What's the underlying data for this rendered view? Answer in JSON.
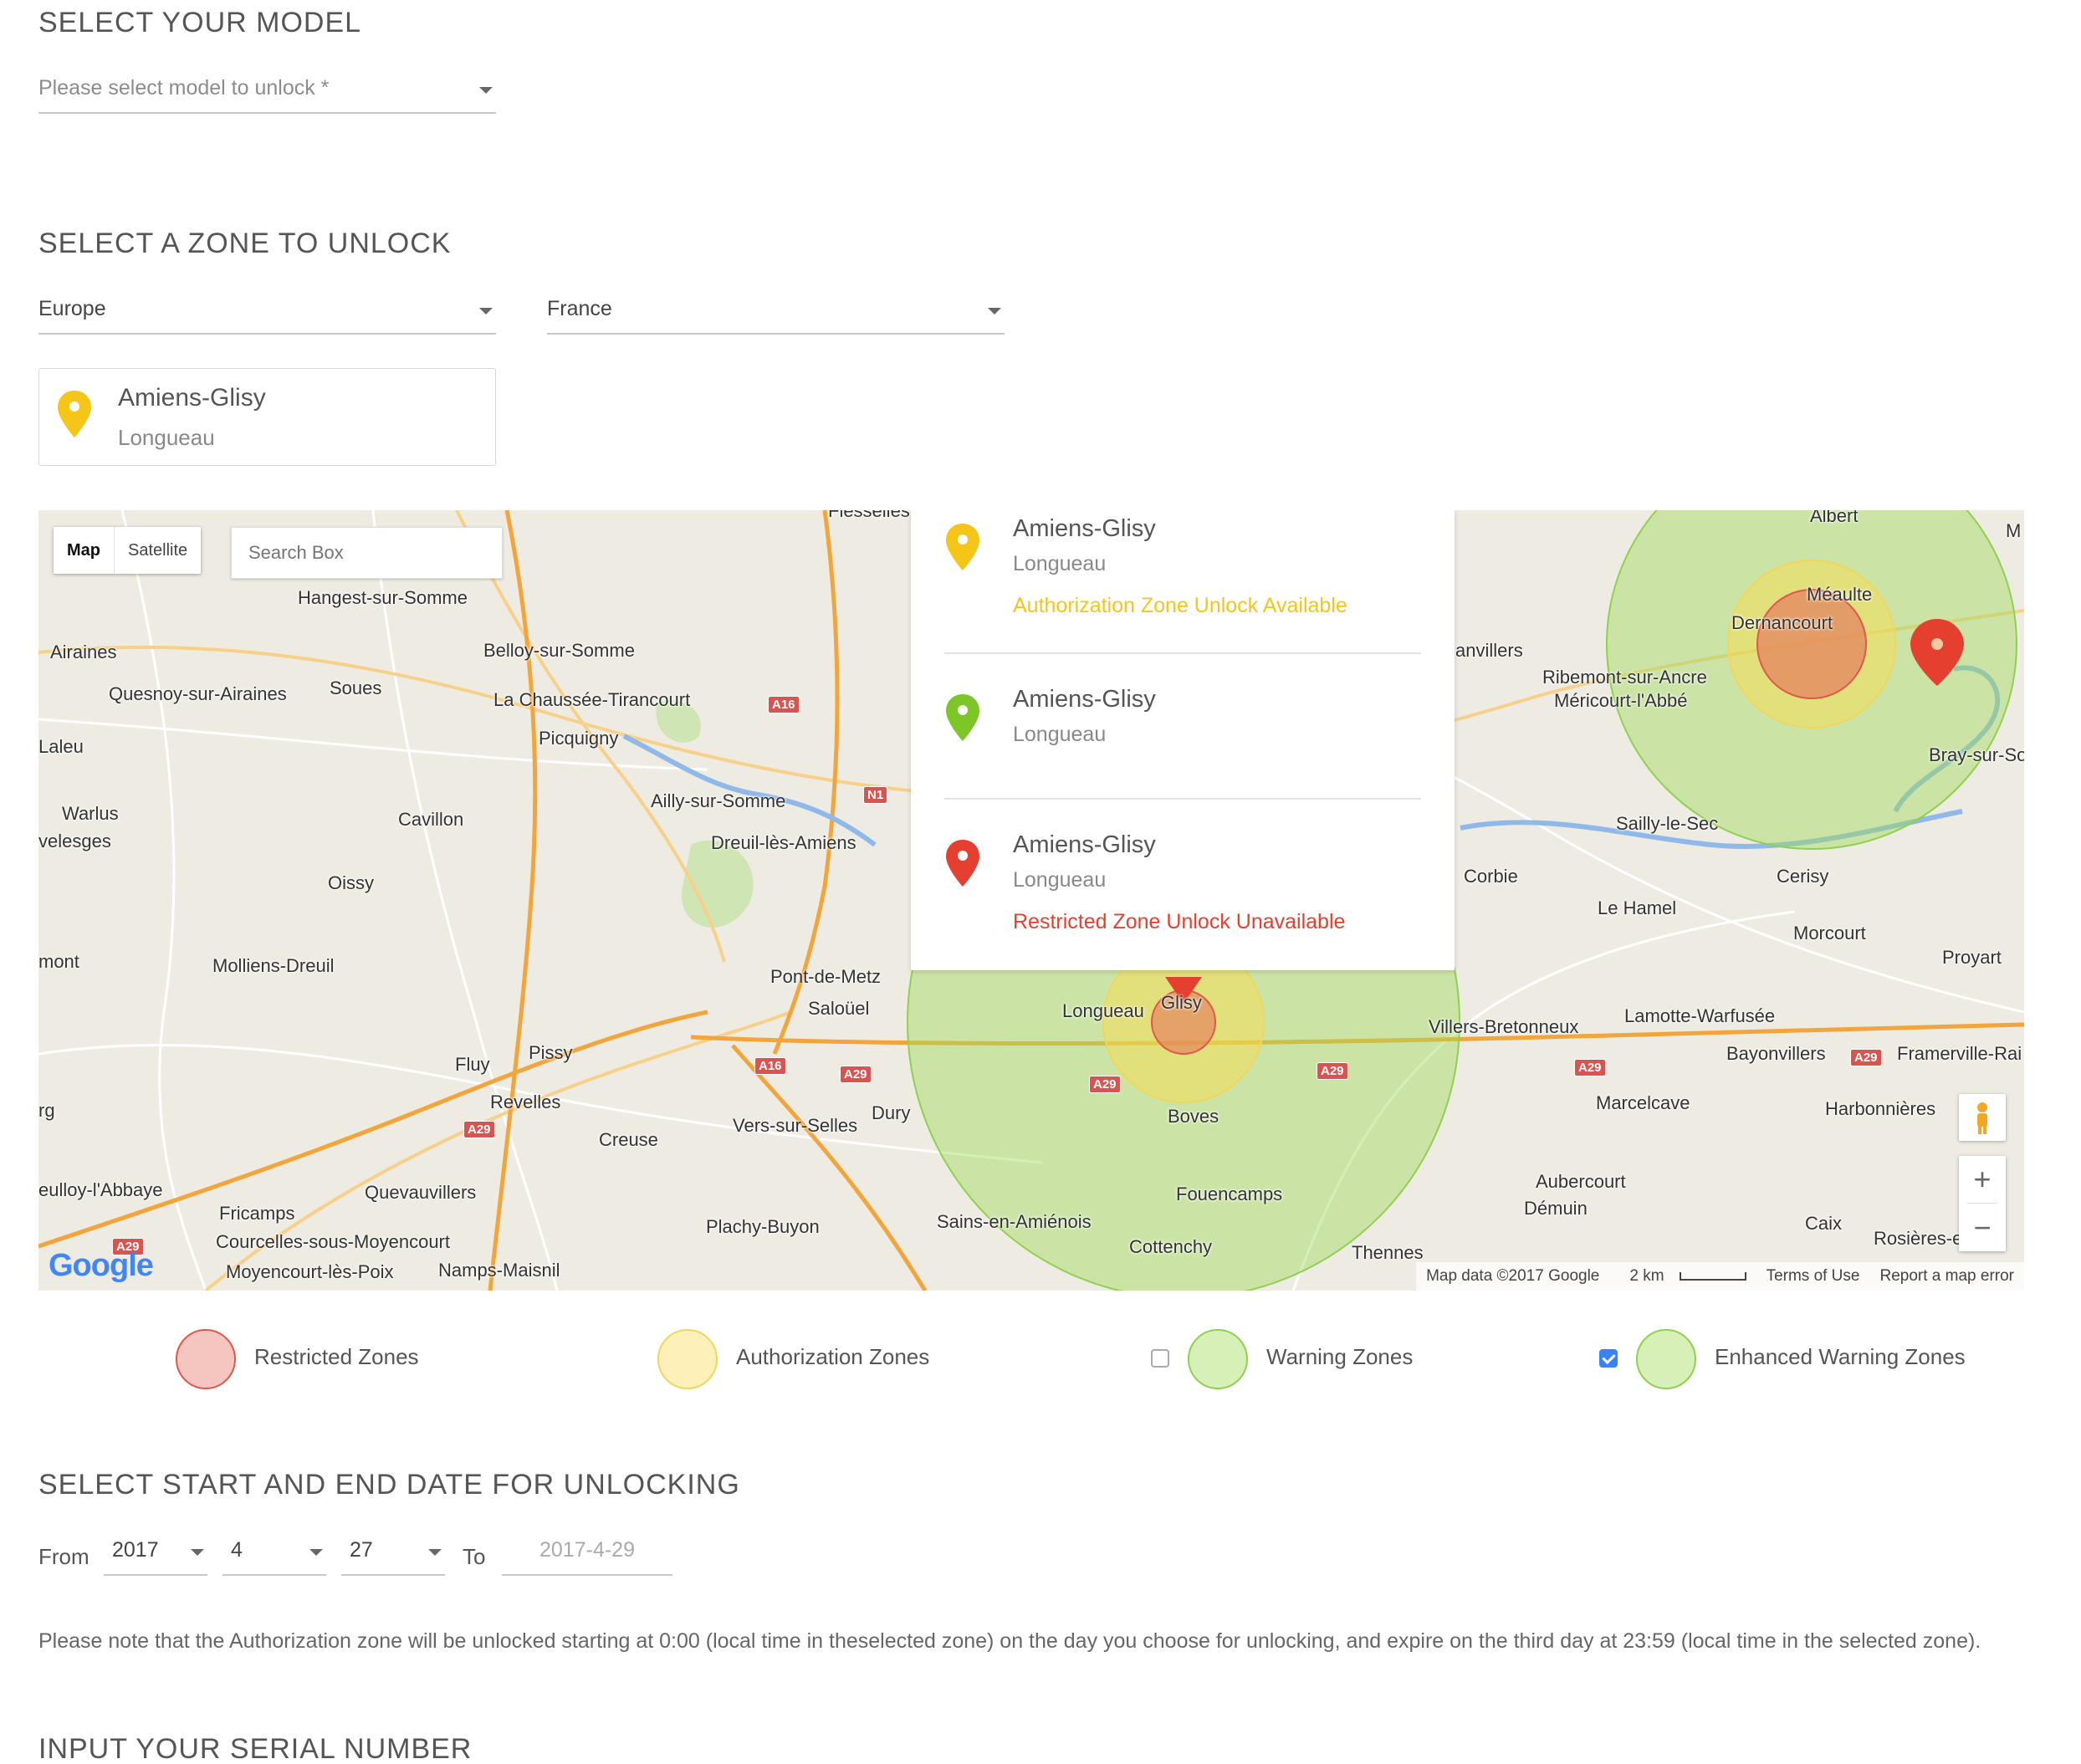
{
  "model_section": {
    "title": "SELECT YOUR MODEL",
    "model_select_placeholder": "Please select model to unlock *"
  },
  "zone_section": {
    "title": "SELECT A ZONE TO UNLOCK",
    "region_select": "Europe",
    "country_select": "France",
    "selected_zone": {
      "name": "Amiens-Glisy",
      "sub": "Longueau"
    }
  },
  "map": {
    "map_type_buttons": [
      "Map",
      "Satellite"
    ],
    "search_placeholder": "Search Box",
    "popup": [
      {
        "name": "Amiens-Glisy",
        "sub": "Longueau",
        "status": "Authorization Zone Unlock Available",
        "pin_color": "#f5c518",
        "status_color": "#f5c518"
      },
      {
        "name": "Amiens-Glisy",
        "sub": "Longueau",
        "status": "",
        "pin_color": "#7cc627",
        "status_color": ""
      },
      {
        "name": "Amiens-Glisy",
        "sub": "Longueau",
        "status": "Restricted Zone Unlock Unavailable",
        "pin_color": "#e53f2f",
        "status_color": "#e53f2f"
      }
    ],
    "place_labels": [
      "Hangest-sur-Somme",
      "Airaines",
      "Belloy-sur-Somme",
      "Soues",
      "Quesnoy-sur-Airaines",
      "La Chaussée-Tirancourt",
      "Picquigny",
      "Laleu",
      "Ailly-sur-Somme",
      "Warlus",
      "velesges",
      "Cavillon",
      "Dreuil-lès-Amiens",
      "Oissy",
      "mont",
      "Molliens-Dreuil",
      "Pont-de-Metz",
      "Saloüel",
      "Longueau",
      "Glisy",
      "Pissy",
      "Fluy",
      "Revelles",
      "Dury",
      "Vers-sur-Selles",
      "Boves",
      "Creuse",
      "rg",
      "Quevauvillers",
      "eulloy-l'Abbaye",
      "Fricamps",
      "Courcelles-sous-Moyencourt",
      "Plachy-Buyon",
      "Fouencamps",
      "Sains-en-Amiénois",
      "Cottenchy",
      "Thennes",
      "Moyencourt-lès-Poix",
      "Namps-Maisnil",
      "Flesselles",
      "Albert",
      "Méaulte",
      "Dernancourt",
      "anvillers",
      "Ribemont-sur-Ancre",
      "Méricourt-l'Abbé",
      "Bray-sur-So",
      "Sailly-le-Sec",
      "Corbie",
      "Cerisy",
      "Le Hamel",
      "Morcourt",
      "Proyart",
      "Lamotte-Warfusée",
      "Villers-Bretonneux",
      "Bayonvillers",
      "Framerville-Rai",
      "Marcelcave",
      "Harbonnières",
      "Aubercourt",
      "Démuin",
      "Caix",
      "Rosières-e",
      "M"
    ],
    "road_shields": [
      "A16",
      "N1",
      "A16",
      "A29",
      "A29",
      "A29",
      "A29",
      "A29",
      "A29",
      "A29"
    ],
    "footer": {
      "map_data": "Map data ©2017 Google",
      "scale": "2 km",
      "terms": "Terms of Use",
      "report": "Report a map error"
    },
    "logo": "Google",
    "zoom_in": "+",
    "zoom_out": "−"
  },
  "legend": [
    {
      "label": "Restricted Zones",
      "fill": "#f5c6c0",
      "stroke": "#e0574a",
      "checkbox": null
    },
    {
      "label": "Authorization Zones",
      "fill": "#fdf0b8",
      "stroke": "#f2d65a",
      "checkbox": null
    },
    {
      "label": "Warning Zones",
      "fill": "#d6f0b8",
      "stroke": "#8fd14f",
      "checkbox": false
    },
    {
      "label": "Enhanced Warning Zones",
      "fill": "#d6f0b8",
      "stroke": "#8fd14f",
      "checkbox": true
    }
  ],
  "date_section": {
    "title": "SELECT START AND END DATE FOR UNLOCKING",
    "from_label": "From",
    "year": "2017",
    "month": "4",
    "day": "27",
    "to_label": "To",
    "end_date": "2017-4-29",
    "note": "Please note that the Authorization zone will be unlocked starting at 0:00 (local time in theselected zone) on the day you choose for unlocking, and expire on the third day at 23:59 (local time in the selected zone)."
  },
  "serial_section": {
    "title": "INPUT YOUR SERIAL NUMBER"
  }
}
